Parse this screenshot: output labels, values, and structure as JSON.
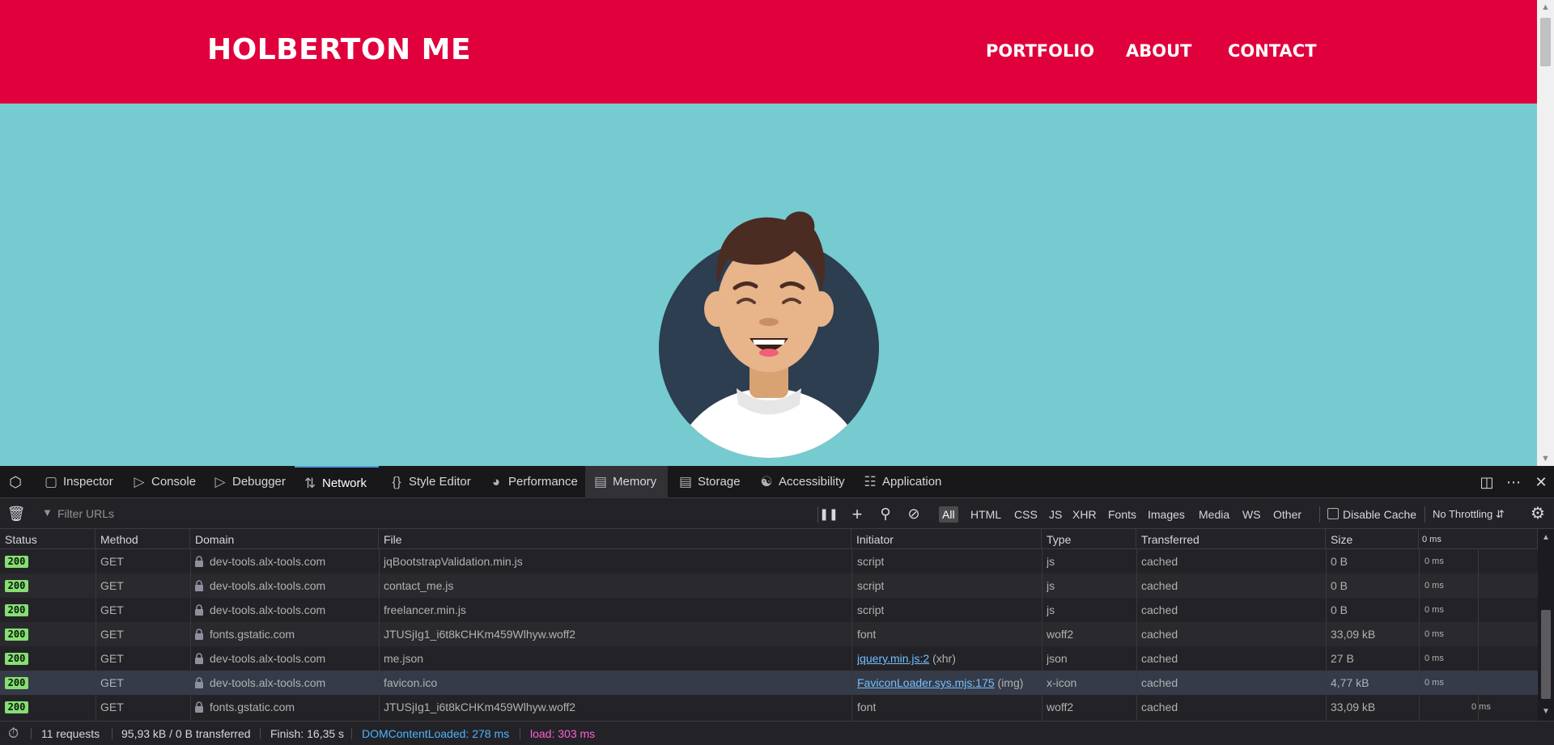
{
  "site": {
    "brand": "HOLBERTON ME",
    "nav": [
      "PORTFOLIO",
      "ABOUT",
      "CONTACT"
    ]
  },
  "devtools": {
    "tabs": [
      "Inspector",
      "Console",
      "Debugger",
      "Network",
      "Style Editor",
      "Performance",
      "Memory",
      "Storage",
      "Accessibility",
      "Application"
    ],
    "selected_tab": "Network",
    "hovered_tab": "Memory",
    "filter_placeholder": "Filter URLs",
    "type_filters": [
      "All",
      "HTML",
      "CSS",
      "JS",
      "XHR",
      "Fonts",
      "Images",
      "Media",
      "WS",
      "Other"
    ],
    "active_type_filter": "All",
    "disable_cache_label": "Disable Cache",
    "throttling": "No Throttling",
    "columns": [
      "Status",
      "Method",
      "Domain",
      "File",
      "Initiator",
      "Type",
      "Transferred",
      "Size",
      "0 ms"
    ],
    "rows": [
      {
        "status": "200",
        "method": "GET",
        "domain": "dev-tools.alx-tools.com",
        "file": "jqBootstrapValidation.min.js",
        "initiator": "script",
        "initiator_suffix": "",
        "type": "js",
        "transferred": "cached",
        "size": "0 B",
        "waterfall": "0 ms"
      },
      {
        "status": "200",
        "method": "GET",
        "domain": "dev-tools.alx-tools.com",
        "file": "contact_me.js",
        "initiator": "script",
        "initiator_suffix": "",
        "type": "js",
        "transferred": "cached",
        "size": "0 B",
        "waterfall": "0 ms"
      },
      {
        "status": "200",
        "method": "GET",
        "domain": "dev-tools.alx-tools.com",
        "file": "freelancer.min.js",
        "initiator": "script",
        "initiator_suffix": "",
        "type": "js",
        "transferred": "cached",
        "size": "0 B",
        "waterfall": "0 ms"
      },
      {
        "status": "200",
        "method": "GET",
        "domain": "fonts.gstatic.com",
        "file": "JTUSjIg1_i6t8kCHKm459Wlhyw.woff2",
        "initiator": "font",
        "initiator_suffix": "",
        "type": "woff2",
        "transferred": "cached",
        "size": "33,09 kB",
        "waterfall": "0 ms"
      },
      {
        "status": "200",
        "method": "GET",
        "domain": "dev-tools.alx-tools.com",
        "file": "me.json",
        "initiator": "jquery.min.js:2",
        "initiator_suffix": " (xhr)",
        "type": "json",
        "transferred": "cached",
        "size": "27 B",
        "waterfall": "0 ms"
      },
      {
        "status": "200",
        "method": "GET",
        "domain": "dev-tools.alx-tools.com",
        "file": "favicon.ico",
        "initiator": "FaviconLoader.sys.mjs:175",
        "initiator_suffix": " (img)",
        "type": "x-icon",
        "transferred": "cached",
        "size": "4,77 kB",
        "waterfall": "0 ms"
      },
      {
        "status": "200",
        "method": "GET",
        "domain": "fonts.gstatic.com",
        "file": "JTUSjIg1_i6t8kCHKm459Wlhyw.woff2",
        "initiator": "font",
        "initiator_suffix": "",
        "type": "woff2",
        "transferred": "cached",
        "size": "33,09 kB",
        "waterfall": "0 ms"
      }
    ],
    "summary": {
      "requests": "11 requests",
      "transferred": "95,93 kB / 0 B transferred",
      "finish": "Finish: 16,35 s",
      "dom_content_loaded": "DOMContentLoaded: 278 ms",
      "load": "load: 303 ms"
    }
  },
  "colors": {
    "brand_red": "#e0003c",
    "hero_teal": "#76cbd0",
    "status_green": "#86de74",
    "dcl_blue": "#4cb3ff",
    "load_pink": "#ff5fd2"
  }
}
